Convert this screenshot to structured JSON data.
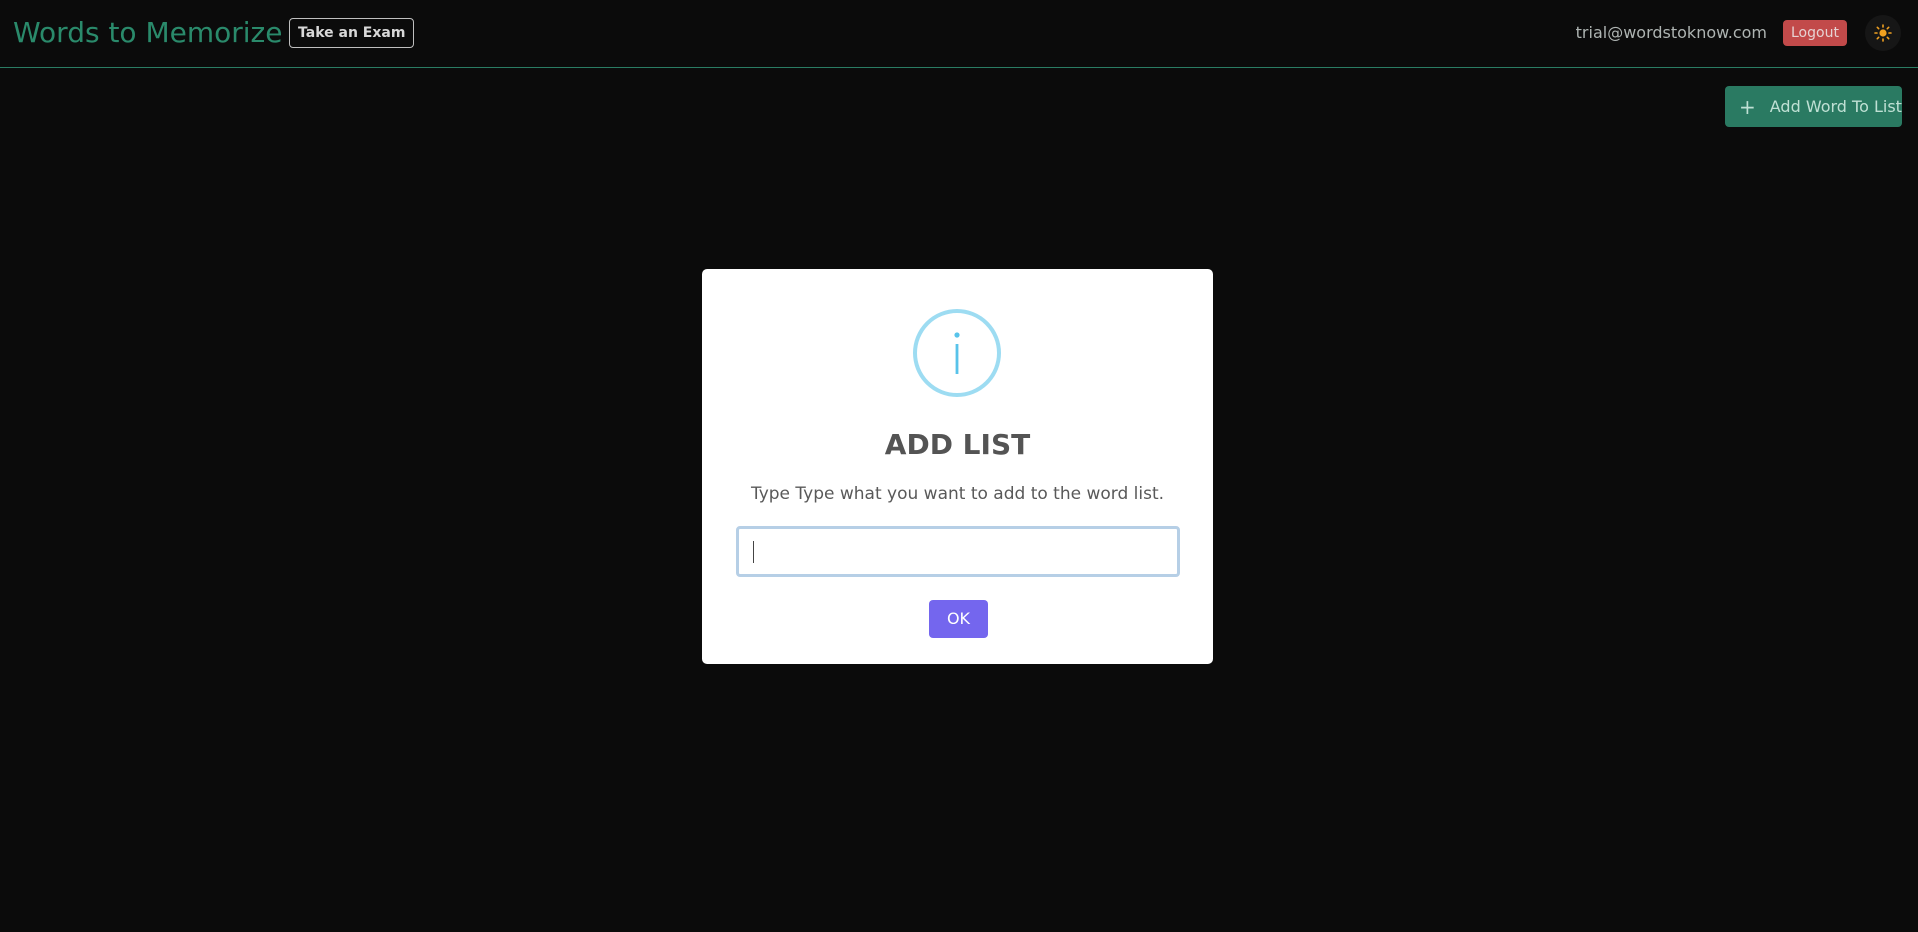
{
  "header": {
    "brand": "Words to Memorize",
    "exam_button": "Take an Exam",
    "user_email": "trial@wordstoknow.com",
    "logout_button": "Logout",
    "theme_toggle_icon": "sun-icon"
  },
  "toolbar": {
    "add_word_button": "Add Word To List",
    "add_word_icon": "plus-icon"
  },
  "modal": {
    "icon": "info-icon",
    "icon_glyph": "i",
    "title": "ADD LIST",
    "text": "Type Type what you want to add to the word list.",
    "input_value": "",
    "ok_button": "OK"
  },
  "colors": {
    "accent_green": "#2a7a62",
    "logout_red": "#c24a4a",
    "ok_purple": "#7466ee",
    "info_blue": "#9ddcf2"
  }
}
